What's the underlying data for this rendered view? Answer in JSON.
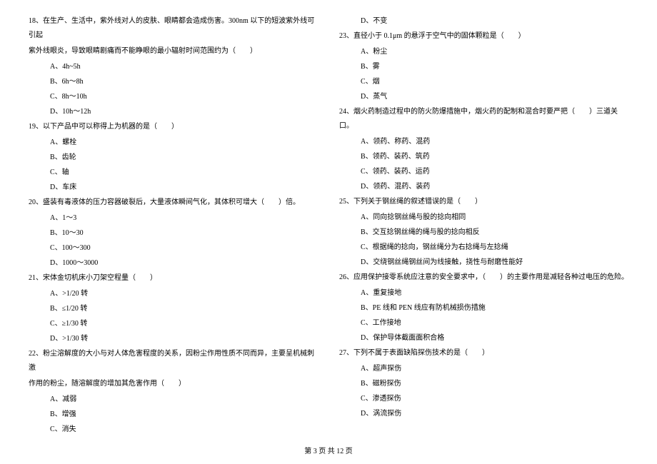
{
  "left_column": {
    "q18": {
      "text1": "18、在生产、生活中，紫外线对人的皮肤、眼睛都会造成伤害。300nm 以下的短波紫外线可引起",
      "text2": "紫外线眼炎，导致眼睛剧痛而不能睁眼的最小辐射时间范围约为（　　）",
      "options": {
        "a": "A、4h~5h",
        "b": "B、6h～8h",
        "c": "C、8h～10h",
        "d": "D、10h～12h"
      }
    },
    "q19": {
      "text": "19、以下产品中可以称得上为机器的是（　　）",
      "options": {
        "a": "A、螺栓",
        "b": "B、齿轮",
        "c": "C、轴",
        "d": "D、车床"
      }
    },
    "q20": {
      "text": "20、盛装有毒液体的压力容器破裂后，大量液体瞬间气化，其体积可增大（　　）倍。",
      "options": {
        "a": "A、1～3",
        "b": "B、10～30",
        "c": "C、100～300",
        "d": "D、1000～3000"
      }
    },
    "q21": {
      "text": "21、宋体金切机床小刀架空程量（　　）",
      "options": {
        "a": "A、>1/20 转",
        "b": "B、≤1/20 转",
        "c": "C、≥1/30 转",
        "d": "D、>1/30 转"
      }
    },
    "q22": {
      "text1": "22、粉尘溶解度的大小与对人体危害程度的关系，因粉尘作用性质不同而异，主要呈机械刺激",
      "text2": "作用的粉尘，随溶解度的增加其危害作用（　　）",
      "options": {
        "a": "A、减弱",
        "b": "B、增强",
        "c": "C、消失"
      }
    }
  },
  "right_column": {
    "q22d": "D、不变",
    "q23": {
      "text": "23、直径小于 0.1μm 的悬浮于空气中的固体颗粒是（　　）",
      "options": {
        "a": "A、粉尘",
        "b": "B、雾",
        "c": "C、烟",
        "d": "D、蒸气"
      }
    },
    "q24": {
      "text": "24、烟火药制造过程中的防火防爆措施中，烟火药的配制和混合时要严把（　　）三道关口。",
      "options": {
        "a": "A、领药、称药、混药",
        "b": "B、领药、装药、筑药",
        "c": "C、领药、装药、运药",
        "d": "D、领药、混药、装药"
      }
    },
    "q25": {
      "text": "25、下列关于钢丝绳的叙述错误的是（　　）",
      "options": {
        "a": "A、同向捻钢丝绳与股的捻向相同",
        "b": "B、交互捻钢丝绳的绳与股的捻向相反",
        "c": "C、根据绳的捻向，钢丝绳分为右捻绳与左捻绳",
        "d": "D、交绕钢丝绳钢丝间为线接触，挠性与耐磨性能好"
      }
    },
    "q26": {
      "text": "26、应用保护接零系统应注意的安全要求中，（　　）的主要作用是减轻各种过电压的危险。",
      "options": {
        "a": "A、重复接地",
        "b": "B、PE 线和 PEN 线应有防机械损伤措施",
        "c": "C、工作接地",
        "d": "D、保护导体截面面积合格"
      }
    },
    "q27": {
      "text": "27、下列不属于表面缺陷探伤技术的是（　　）",
      "options": {
        "a": "A、超声探伤",
        "b": "B、磁粉探伤",
        "c": "C、渗透探伤",
        "d": "D、涡流探伤"
      }
    }
  },
  "footer": "第 3 页 共 12 页"
}
